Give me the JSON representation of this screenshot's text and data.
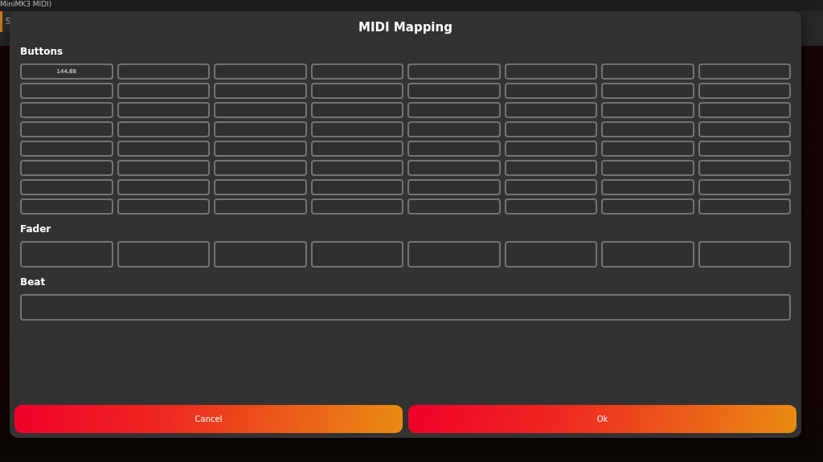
{
  "background": {
    "window_title": "MiniMK3 MIDI)",
    "tab": "S"
  },
  "dialog": {
    "title": "MIDI Mapping",
    "sections": [
      {
        "label": "Buttons",
        "kind": "small",
        "rows": [
          [
            {
              "value": "144,88"
            },
            {},
            {},
            {},
            {},
            {},
            {},
            {}
          ],
          [
            {},
            {},
            {},
            {},
            {},
            {},
            {},
            {}
          ],
          [
            {},
            {},
            {},
            {},
            {},
            {},
            {},
            {}
          ],
          [
            {},
            {},
            {},
            {},
            {},
            {},
            {},
            {}
          ],
          [
            {},
            {},
            {},
            {},
            {},
            {},
            {},
            {}
          ],
          [
            {},
            {},
            {},
            {},
            {},
            {},
            {},
            {}
          ],
          [
            {},
            {},
            {},
            {},
            {},
            {},
            {},
            {}
          ],
          [
            {},
            {},
            {},
            {},
            {},
            {},
            {},
            {}
          ]
        ]
      },
      {
        "label": "Fader",
        "kind": "tall",
        "rows": [
          [
            {},
            {},
            {},
            {},
            {},
            {},
            {},
            {}
          ]
        ]
      },
      {
        "label": "Beat",
        "kind": "tall",
        "rows": [
          [
            {}
          ]
        ]
      }
    ],
    "buttons": [
      "Cancel",
      "Ok"
    ]
  }
}
